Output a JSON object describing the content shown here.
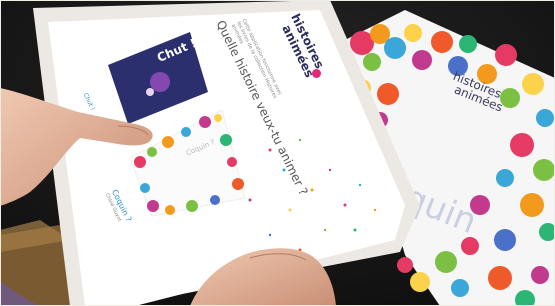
{
  "tablet_app": {
    "logo_line1": "histoires",
    "logo_line2": "animées",
    "headline": "Quelle histoire veux-tu animer ?",
    "intro_line1": "Cette application fonctionne avec",
    "intro_line2": "les livres de la collection Histoires",
    "intro_line3": "animées",
    "books": [
      {
        "cover_title": "Chut !",
        "caption_title": "Chut !",
        "caption_author": "Chloé Guyot"
      },
      {
        "cover_title": "Coquin ?",
        "caption_title": "Coquin ?",
        "caption_author": "Chloé Guyot"
      }
    ]
  },
  "printed_book": {
    "logo_line1": "histoires",
    "logo_line2": "animées",
    "title_fragment": "Coquin ?"
  },
  "colors": {
    "accent": "#e6267a",
    "tablet_frame": "#ece8e3",
    "screen": "#ffffff",
    "desk": "#7a5a30"
  }
}
